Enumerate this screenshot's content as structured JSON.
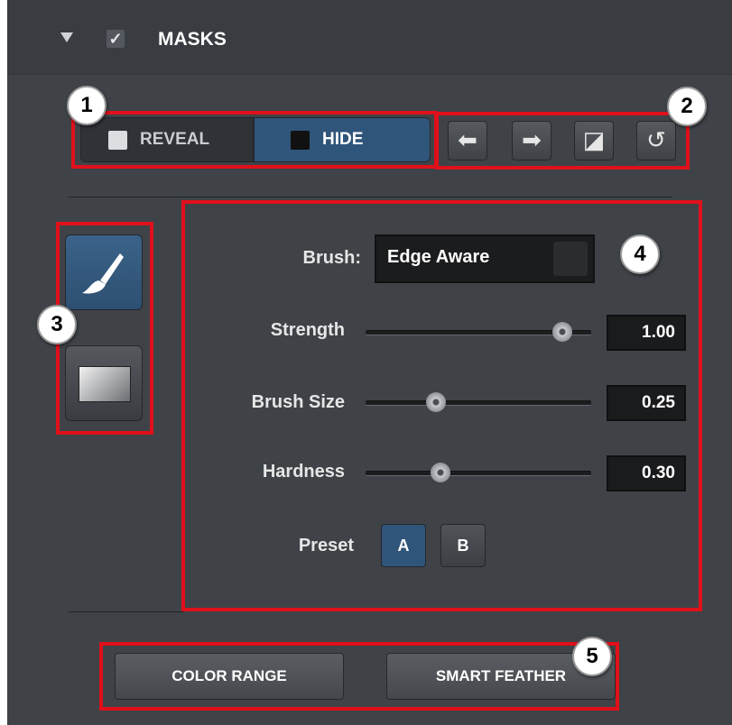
{
  "colors": {
    "panel_bg": "#3f4348",
    "accent_blue": "#30557a",
    "highlight_red": "#e0101a"
  },
  "header": {
    "collapse_icon": "triangle-down-icon",
    "checkbox_icon": "checkmark-icon",
    "checked": true,
    "title": "MASKS"
  },
  "mode": {
    "reveal_label": "REVEAL",
    "hide_label": "HIDE",
    "active": "HIDE"
  },
  "toolbar": {
    "buttons": [
      {
        "name": "undo",
        "icon": "undo-arrow-icon",
        "glyph": "⬅"
      },
      {
        "name": "redo",
        "icon": "redo-arrow-icon",
        "glyph": "➡"
      },
      {
        "name": "invert",
        "icon": "invert-mask-icon",
        "glyph": "◪"
      },
      {
        "name": "reset",
        "icon": "reset-icon",
        "glyph": "↺"
      }
    ]
  },
  "tools": {
    "items": [
      {
        "name": "brush",
        "icon": "paintbrush-icon",
        "active": true
      },
      {
        "name": "gradient",
        "icon": "gradient-icon",
        "active": false
      }
    ]
  },
  "brush": {
    "label": "Brush:",
    "value": "Edge Aware",
    "sliders": [
      {
        "label": "Strength",
        "value": "1.00",
        "fraction": 0.87
      },
      {
        "label": "Brush Size",
        "value": "0.25",
        "fraction": 0.31
      },
      {
        "label": "Hardness",
        "value": "0.30",
        "fraction": 0.33
      }
    ],
    "preset_label": "Preset",
    "preset_a": "A",
    "preset_b": "B",
    "preset_active": "A"
  },
  "actions": {
    "color_range": "COLOR RANGE",
    "smart_feather": "SMART FEATHER"
  },
  "callouts": [
    "1",
    "2",
    "3",
    "4",
    "5"
  ]
}
